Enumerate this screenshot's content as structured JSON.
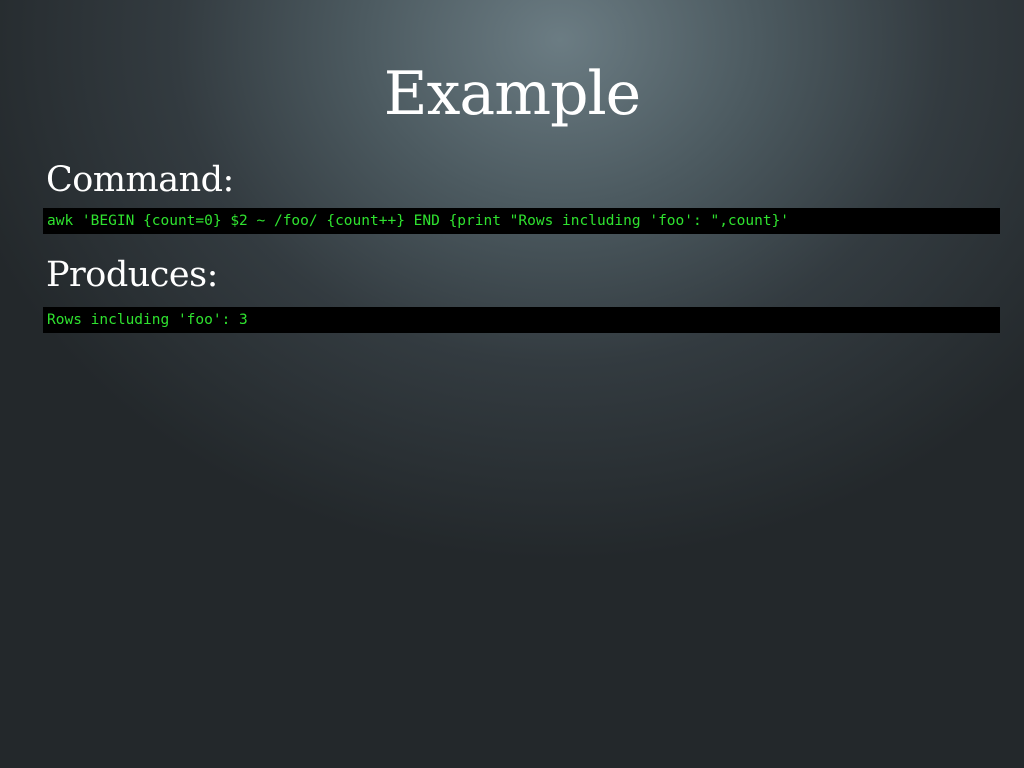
{
  "slide": {
    "title": "Example",
    "command_label": "Command:",
    "command_code": "awk 'BEGIN {count=0} $2 ~ /foo/ {count++} END {print \"Rows including 'foo': \",count}'",
    "produces_label": "Produces:",
    "output_code": "Rows including 'foo': 3"
  },
  "colors": {
    "code_text": "#2fe22f",
    "code_background": "#000000",
    "heading_text": "#ffffff"
  }
}
